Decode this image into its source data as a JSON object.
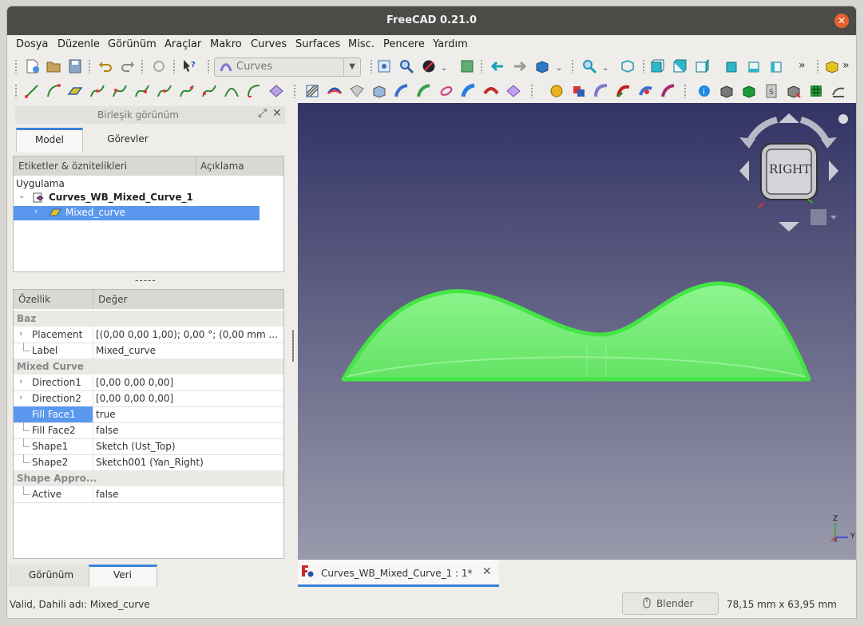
{
  "window": {
    "title": "FreeCAD 0.21.0"
  },
  "menu": [
    "Dosya",
    "Düzenle",
    "Görünüm",
    "Araçlar",
    "Makro",
    "Curves",
    "Surfaces",
    "Misc.",
    "Pencere",
    "Yardım"
  ],
  "workbench_selector": {
    "value": "Curves"
  },
  "toolbar": {
    "overflow": "»"
  },
  "panel": {
    "title": "Birleşik görünüm",
    "tabs": [
      "Model",
      "Görevler"
    ],
    "tree": {
      "columns": [
        "Etiketler & öznitelikleri",
        "Açıklama"
      ],
      "root": "Uygulama",
      "document": "Curves_WB_Mixed_Curve_1",
      "object": "Mixed_curve"
    },
    "splitter": "-----",
    "properties": {
      "columns": [
        "Özellik",
        "Değer"
      ],
      "groups": [
        {
          "name": "Baz",
          "rows": [
            {
              "name": "Placement",
              "value": "[(0,00 0,00 1,00); 0,00 °; (0,00 mm  ...",
              "expandable": true
            },
            {
              "name": "Label",
              "value": "Mixed_curve",
              "expandable": false
            }
          ]
        },
        {
          "name": "Mixed Curve",
          "rows": [
            {
              "name": "Direction1",
              "value": "[0,00 0,00 0,00]",
              "expandable": true
            },
            {
              "name": "Direction2",
              "value": "[0,00 0,00 0,00]",
              "expandable": true
            },
            {
              "name": "Fill Face1",
              "value": "true",
              "expandable": false,
              "selected": true
            },
            {
              "name": "Fill Face2",
              "value": "false",
              "expandable": false
            },
            {
              "name": "Shape1",
              "value": "Sketch (Ust_Top)",
              "expandable": false
            },
            {
              "name": "Shape2",
              "value": "Sketch001 (Yan_Right)",
              "expandable": false
            }
          ]
        },
        {
          "name": "Shape Appro...",
          "rows": [
            {
              "name": "Active",
              "value": "false",
              "expandable": false
            }
          ]
        }
      ]
    },
    "bottom_tabs": [
      "Görünüm",
      "Veri"
    ]
  },
  "navcube": {
    "face": "RIGHT"
  },
  "axes": {
    "z": "Z",
    "y": "Y",
    "x": "X"
  },
  "doc_tab": {
    "label": "Curves_WB_Mixed_Curve_1 : 1*"
  },
  "status": {
    "message": "Valid, Dahili adı: Mixed_curve",
    "nav_style": "Blender",
    "dimensions": "78,15 mm x 63,95 mm"
  },
  "colors": {
    "accent": "#3c82d6",
    "selection": "#5a97ee",
    "shape_fill": "#6ef06e",
    "shape_edge": "#3ee03e",
    "titlebar": "#4d4b48",
    "close": "#e7622f"
  }
}
